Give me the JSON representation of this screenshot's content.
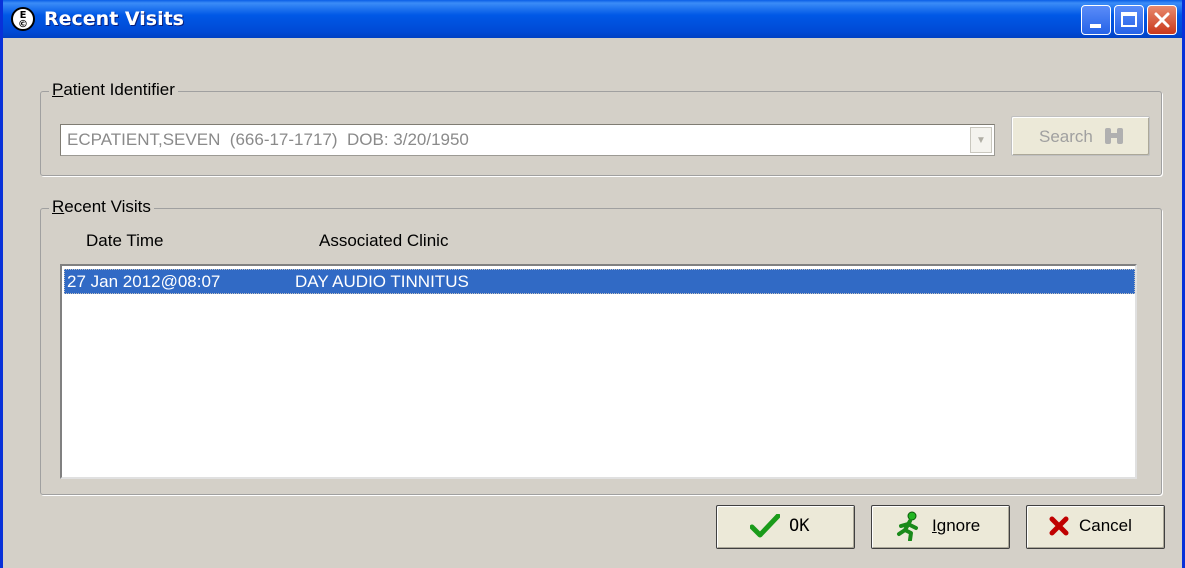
{
  "window": {
    "title": "Recent Visits",
    "controls": [
      "minimize",
      "maximize",
      "close"
    ]
  },
  "patient_identifier": {
    "legend_access_key": "P",
    "legend_rest": "atient Identifier",
    "combo_value": "ECPATIENT,SEVEN  (666-17-1717)  DOB: 3/20/1950",
    "search_label": "Search"
  },
  "recent_visits": {
    "legend_access_key": "R",
    "legend_rest": "ecent Visits",
    "columns": [
      "Date Time",
      "Associated Clinic"
    ],
    "rows": [
      {
        "date_time": "27 Jan 2012@08:07",
        "clinic": "DAY AUDIO TINNITUS",
        "selected": true
      }
    ]
  },
  "buttons": {
    "ok_label": "OK",
    "ignore_access_key": "I",
    "ignore_rest": "gnore",
    "cancel_label": "Cancel"
  },
  "icons": {
    "app": "app-logo-icon",
    "search": "binoculars-icon",
    "ok": "checkmark-icon",
    "ignore": "running-person-icon",
    "cancel": "x-mark-icon"
  },
  "colors": {
    "titlebar": "#0054e3",
    "selection": "#316ac5",
    "dialog_bg": "#d4d0c8"
  }
}
